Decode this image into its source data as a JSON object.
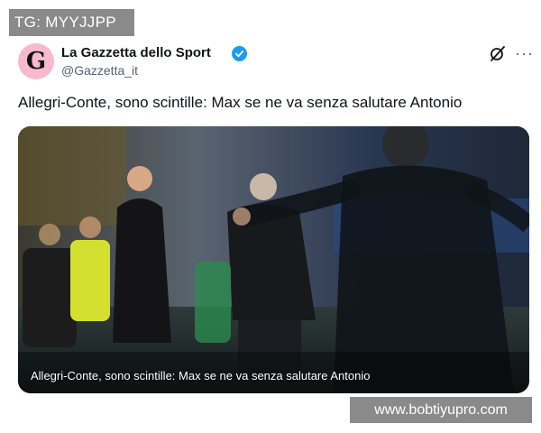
{
  "overlay_top": {
    "text": "TG: MYYJJPP"
  },
  "tweet": {
    "avatar_letter": "G",
    "display_name": "La Gazzetta dello Sport",
    "handle": "@Gazzetta_it",
    "text": "Allegri-Conte, sono scintille: Max se ne va senza salutare Antonio",
    "media_caption": "Allegri-Conte, sono scintille: Max se ne va senza salutare Antonio",
    "icons": {
      "verified": "verified-badge-icon",
      "grok": "grok-icon",
      "more": "more-icon"
    }
  },
  "overlay_bottom": {
    "text": "www.bobtiyupro.com"
  },
  "colors": {
    "accent": "#1d9bf0",
    "avatar_bg": "#f8b9cf",
    "badge_bg": "#8a8a8a",
    "secondary_text": "#536471"
  }
}
